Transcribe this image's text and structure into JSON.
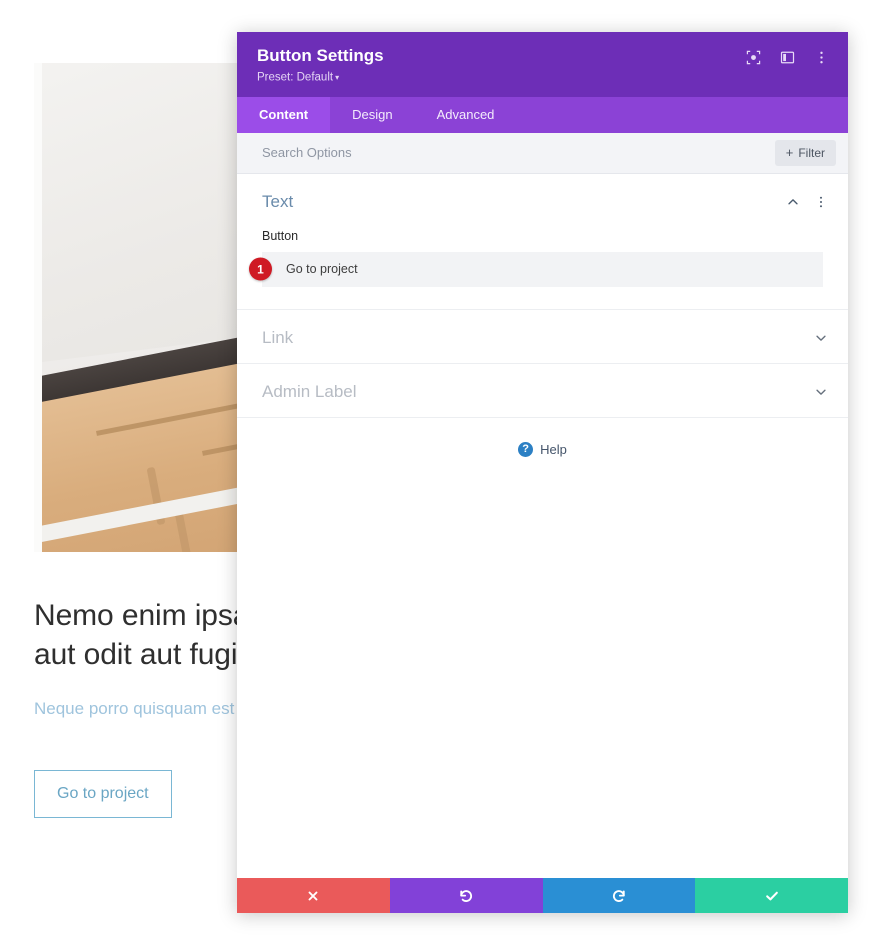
{
  "background_page": {
    "photo_alt": "wooden-slat-stairs-photo",
    "heading": "Nemo enim ipsam\naut odit aut fugit",
    "paragraph": "Neque porro quisquam est",
    "button_label": "Go to project",
    "button_border_color": "#7ab7d4",
    "paragraph_color": "#9fc4dd"
  },
  "modal": {
    "title": "Button Settings",
    "preset_label": "Preset: Default",
    "preset_caret": "▾",
    "header_color": "#6d2eb7",
    "tabs_bar_color": "#8b42d6",
    "active_tab_color": "#9b4de8",
    "header_icons": [
      {
        "name": "focus-icon",
        "label": "Focus"
      },
      {
        "name": "layout-toggle-icon",
        "label": "Layout"
      },
      {
        "name": "kebab-menu-icon",
        "label": "More options"
      }
    ],
    "tabs": [
      {
        "label": "Content",
        "active": true
      },
      {
        "label": "Design",
        "active": false
      },
      {
        "label": "Advanced",
        "active": false
      }
    ],
    "search": {
      "placeholder": "Search Options",
      "value": ""
    },
    "filter_button": {
      "plus": "+",
      "label": "Filter"
    },
    "sections": [
      {
        "title": "Text",
        "expanded": true,
        "chevron": "up",
        "field_label": "Button",
        "field_value": "Go to project",
        "step_badge": "1"
      },
      {
        "title": "Link",
        "expanded": false,
        "chevron": "down"
      },
      {
        "title": "Admin Label",
        "expanded": false,
        "chevron": "down"
      }
    ],
    "help": {
      "icon_glyph": "?",
      "label": "Help",
      "icon_color": "#2c80c4"
    },
    "footer_buttons": [
      {
        "name": "close-button",
        "icon": "close-icon",
        "glyph": "✖",
        "color": "#ea5a5a"
      },
      {
        "name": "undo-button",
        "icon": "undo-icon",
        "glyph": "↺",
        "color": "#8241d8"
      },
      {
        "name": "redo-button",
        "icon": "redo-icon",
        "glyph": "↻",
        "color": "#2a8fd4"
      },
      {
        "name": "save-button",
        "icon": "check-icon",
        "glyph": "✔",
        "color": "#2bcfa2"
      }
    ]
  }
}
